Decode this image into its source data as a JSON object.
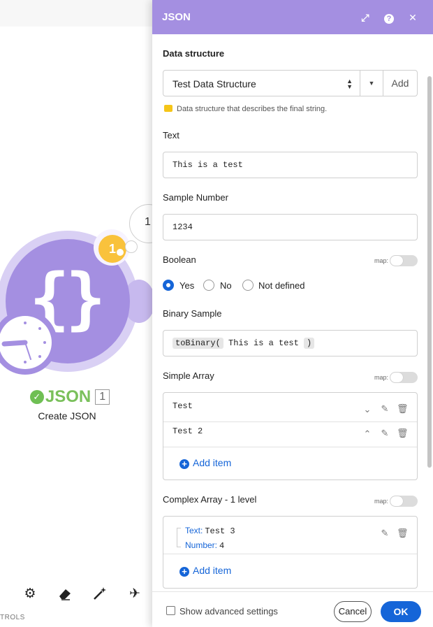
{
  "colors": {
    "accent": "#a48fe1",
    "primary_blue": "#1565d8",
    "success_green": "#7ac05b",
    "badge_yellow": "#f9c23c"
  },
  "canvas": {
    "route_number": "1",
    "badge_count": "1",
    "module_icon": "curly-braces-icon",
    "module_name": "JSON",
    "module_number": "1",
    "module_subtitle": "Create JSON",
    "toolbar_icons": [
      "gear-icon",
      "eraser-icon",
      "magic-wand-icon",
      "airplane-icon"
    ],
    "controls_label": "TROLS"
  },
  "panel": {
    "title": "JSON",
    "header_icons": [
      "expand-icon",
      "help-icon",
      "close-icon"
    ],
    "data_structure": {
      "label": "Data structure",
      "selected": "Test Data Structure",
      "add_label": "Add",
      "hint": "Data structure that describes the final string."
    },
    "text": {
      "label": "Text",
      "value": "This is a test"
    },
    "sample_number": {
      "label": "Sample Number",
      "value": "1234"
    },
    "map_label": "map:",
    "boolean": {
      "label": "Boolean",
      "options": [
        "Yes",
        "No",
        "Not defined"
      ],
      "selected": "Yes"
    },
    "binary_sample": {
      "label": "Binary Sample",
      "func_open": "toBinary(",
      "arg": "This is a test",
      "func_close": ")"
    },
    "simple_array": {
      "label": "Simple Array",
      "items": [
        "Test",
        "Test 2"
      ],
      "add_item": "Add item"
    },
    "complex_array": {
      "label": "Complex Array - 1 level",
      "item": {
        "text_key": "Text:",
        "text_val": "Test 3",
        "number_key": "Number:",
        "number_val": "4"
      },
      "add_item": "Add item"
    },
    "footer": {
      "advanced_label": "Show advanced settings",
      "cancel": "Cancel",
      "ok": "OK"
    }
  }
}
